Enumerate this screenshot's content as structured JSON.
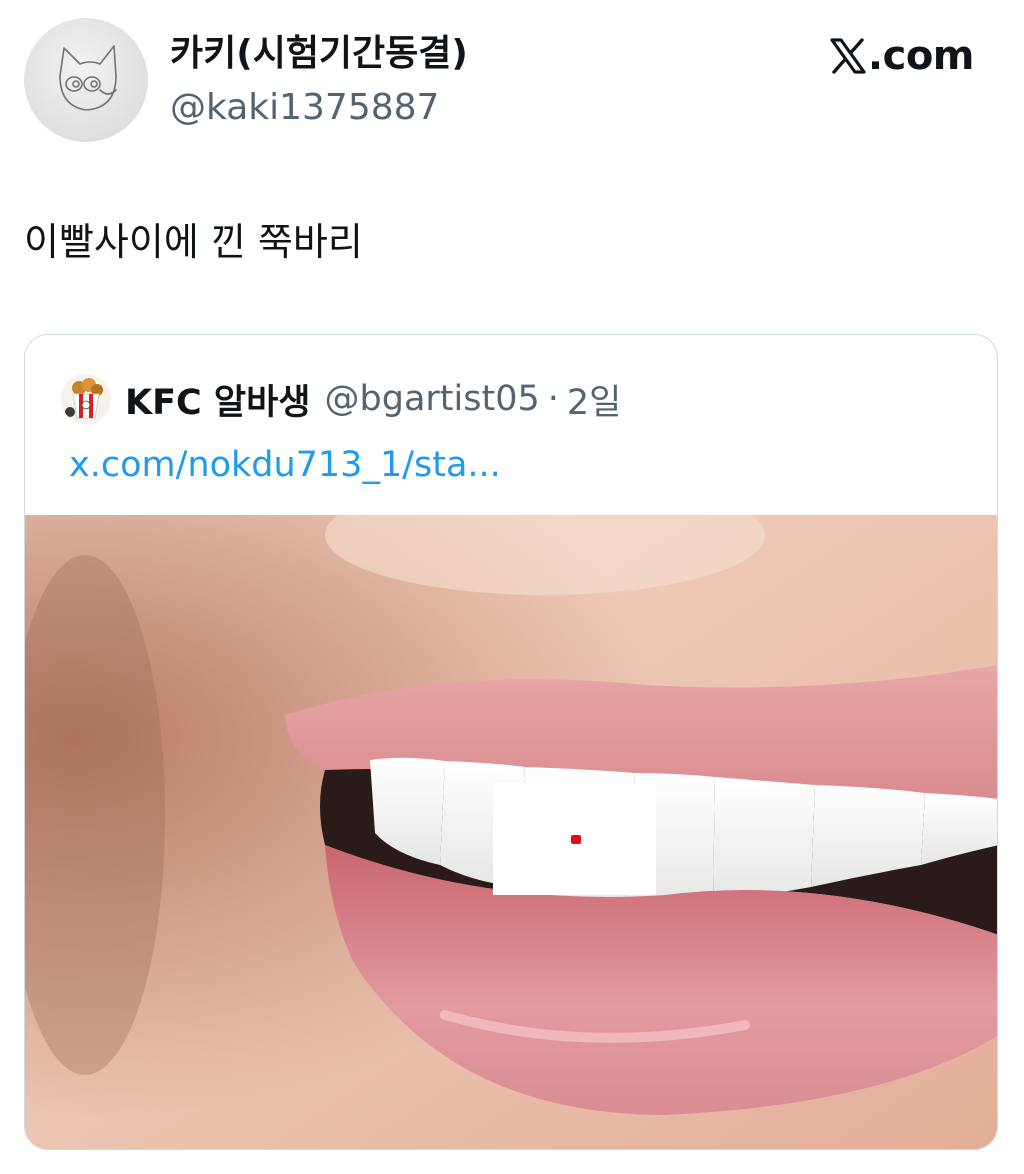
{
  "tweet": {
    "author": {
      "display_name": "카키(시험기간동결)",
      "handle": "@kaki1375887"
    },
    "text": "이빨사이에 낀 쭉바리"
  },
  "brand": {
    "text": ".com",
    "icon": "x-logo-icon"
  },
  "quoted_tweet": {
    "author": {
      "display_name": "KFC 알바생",
      "handle": "@bgartist05"
    },
    "separator": "·",
    "time": "2일",
    "link": "x.com/nokdu713_1/sta..."
  },
  "colors": {
    "text_primary": "#0f1419",
    "text_secondary": "#536471",
    "link": "#1d9bf0",
    "border": "#cfd9de",
    "marker": "#e0101a"
  }
}
